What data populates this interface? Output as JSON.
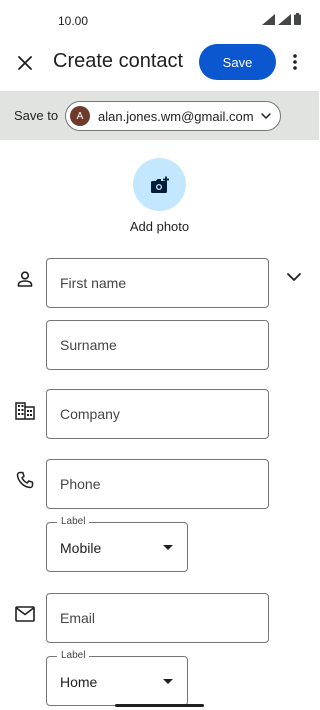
{
  "status_bar": {
    "time": "10.00"
  },
  "app_bar": {
    "title": "Create contact",
    "save_label": "Save"
  },
  "save_to": {
    "label": "Save to",
    "avatar_letter": "A",
    "email": "alan.jones.wm@gmail.com"
  },
  "photo": {
    "label": "Add photo"
  },
  "fields": {
    "first_name": "First name",
    "surname": "Surname",
    "company": "Company",
    "phone": "Phone",
    "phone_label_legend": "Label",
    "phone_label_value": "Mobile",
    "email": "Email",
    "email_label_legend": "Label",
    "email_label_value": "Home"
  },
  "colors": {
    "accent": "#0b57d0",
    "bar_bg": "#e1e3e1",
    "photo_bg": "#c2e7ff",
    "avatar_bg": "#6d3a2c"
  },
  "icons": [
    "close-icon",
    "more-vert-icon",
    "add-photo-icon",
    "person-icon",
    "expand-icon",
    "business-icon",
    "phone-icon",
    "email-icon",
    "signal-icon",
    "battery-icon"
  ]
}
